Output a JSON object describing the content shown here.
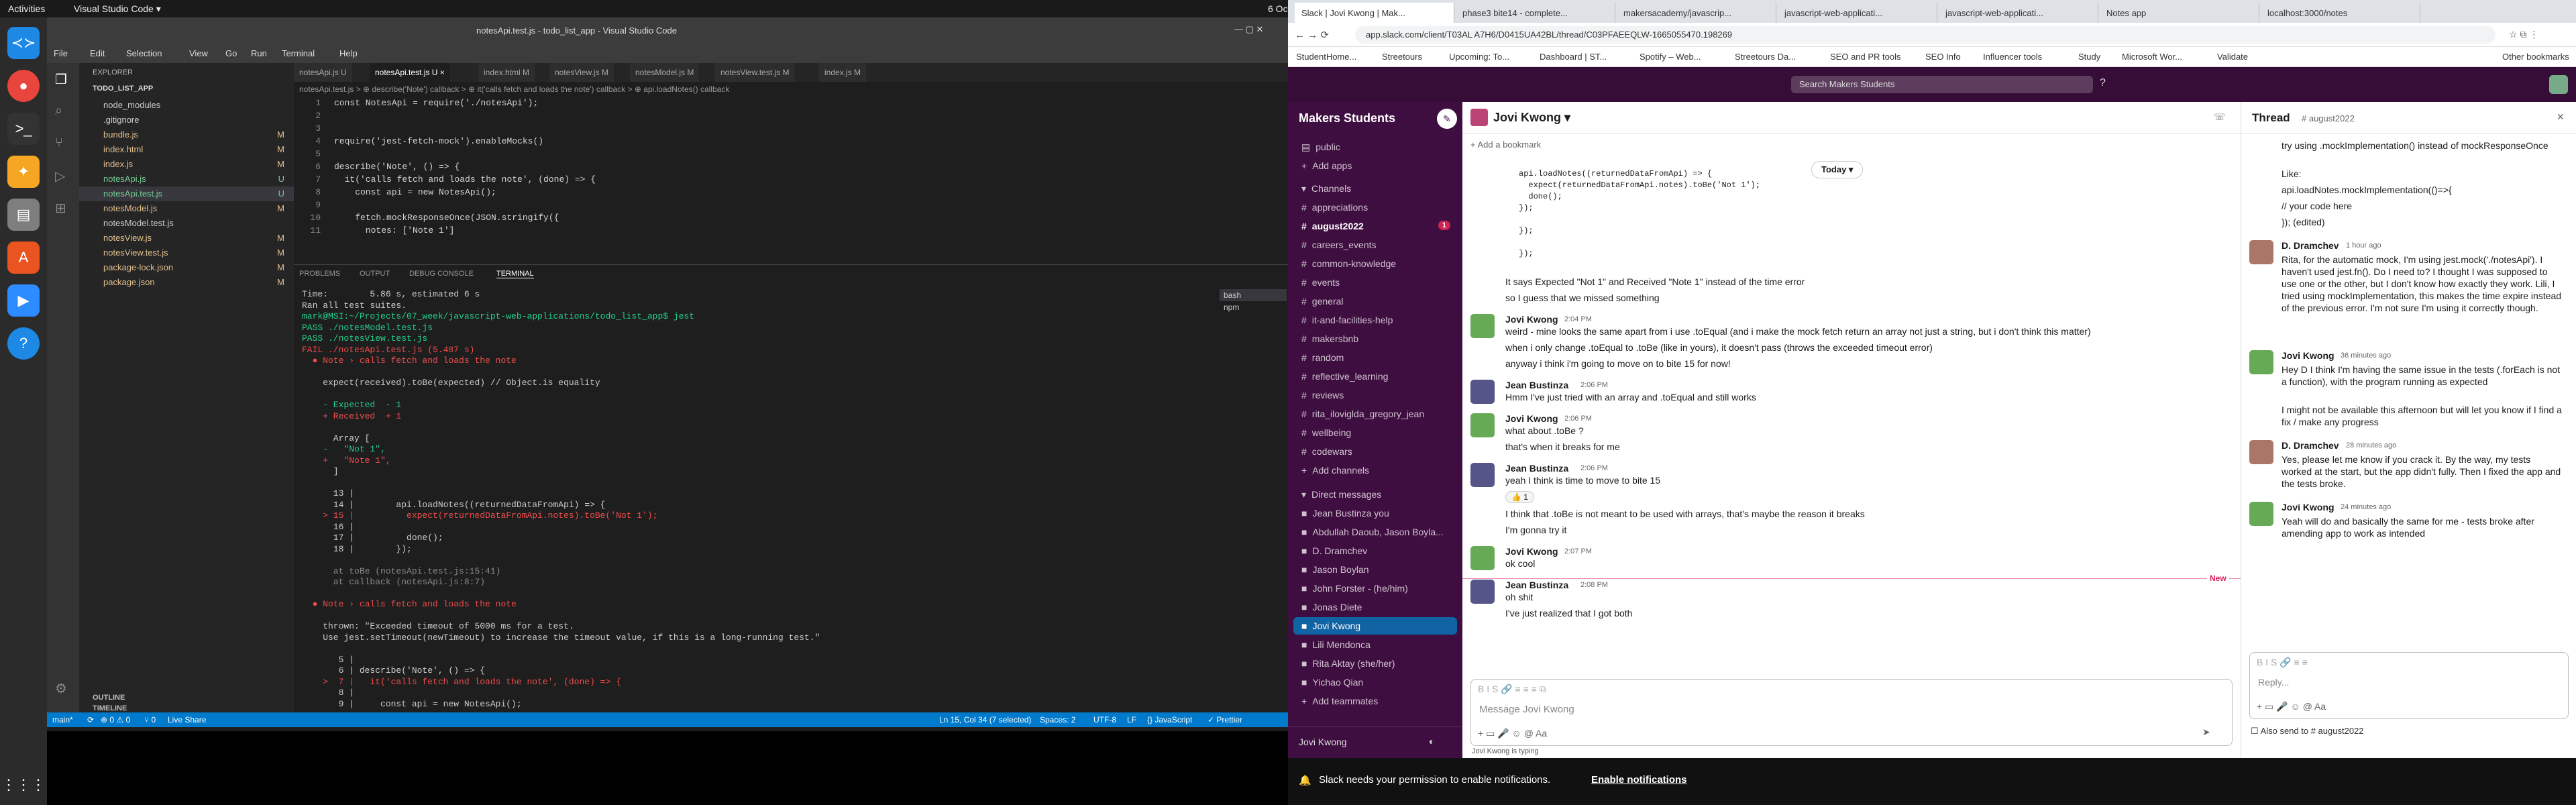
{
  "system": {
    "activities": "Activities",
    "app_name": "Visual Studio Code ▾",
    "clock": "6 Oct 14:09"
  },
  "vscode": {
    "title": "notesApi.test.js - todo_list_app - Visual Studio Code",
    "menu": [
      "File",
      "Edit",
      "Selection",
      "View",
      "Go",
      "Run",
      "Terminal",
      "Help"
    ],
    "explorer_header": "EXPLORER",
    "project": "TODO_LIST_APP",
    "files": [
      {
        "name": "node_modules",
        "badge": ""
      },
      {
        "name": ".gitignore",
        "badge": ""
      },
      {
        "name": "bundle.js",
        "badge": "M"
      },
      {
        "name": "index.html",
        "badge": "M"
      },
      {
        "name": "index.js",
        "badge": "M"
      },
      {
        "name": "notesApi.js",
        "badge": "U"
      },
      {
        "name": "notesApi.test.js",
        "badge": "U"
      },
      {
        "name": "notesModel.js",
        "badge": "M"
      },
      {
        "name": "notesModel.test.js",
        "badge": ""
      },
      {
        "name": "notesView.js",
        "badge": "M"
      },
      {
        "name": "notesView.test.js",
        "badge": "M"
      },
      {
        "name": "package-lock.json",
        "badge": "M"
      },
      {
        "name": "package.json",
        "badge": "M"
      }
    ],
    "outline": "OUTLINE",
    "timeline": "TIMELINE",
    "tabs": [
      "notesApi.js U",
      "notesApi.test.js U ×",
      "index.html M",
      "notesView.js M",
      "notesModel.js M",
      "notesView.test.js M",
      "index.js M"
    ],
    "breadcrumb": "notesApi.test.js > ⊕ describe('Note') callback > ⊕ it('calls fetch and loads the note') callback > ⊕ api.loadNotes() callback",
    "code": [
      {
        "n": "1",
        "t": "const NotesApi = require('./notesApi');"
      },
      {
        "n": "2",
        "t": ""
      },
      {
        "n": "3",
        "t": ""
      },
      {
        "n": "4",
        "t": "require('jest-fetch-mock').enableMocks()"
      },
      {
        "n": "5",
        "t": ""
      },
      {
        "n": "6",
        "t": "describe('Note', () => {"
      },
      {
        "n": "7",
        "t": "  it('calls fetch and loads the note', (done) => {"
      },
      {
        "n": "8",
        "t": "    const api = new NotesApi();"
      },
      {
        "n": "9",
        "t": ""
      },
      {
        "n": "10",
        "t": "    fetch.mockResponseOnce(JSON.stringify({"
      },
      {
        "n": "11",
        "t": "      notes: ['Note 1']"
      }
    ],
    "panel_tabs": [
      "PROBLEMS",
      "OUTPUT",
      "DEBUG CONSOLE",
      "TERMINAL"
    ],
    "terminal_side": [
      "bash",
      "npm"
    ],
    "terminal": [
      "Time:        5.86 s, estimated 6 s",
      "Ran all test suites.",
      "mark@MSI:~/Projects/07_week/javascript-web-applications/todo_list_app$ jest",
      "PASS ./notesModel.test.js",
      "PASS ./notesView.test.js",
      "FAIL ./notesApi.test.js (5.487 s)",
      "  ● Note › calls fetch and loads the note",
      "",
      "    expect(received).toBe(expected) // Object.is equality",
      "",
      "    - Expected  - 1",
      "    + Received  + 1",
      "",
      "      Array [",
      "    -   \"Not 1\",",
      "    +   \"Note 1\",",
      "      ]",
      "",
      "      13 |",
      "      14 |        api.loadNotes((returnedDataFromApi) => {",
      "    > 15 |          expect(returnedDataFromApi.notes).toBe('Not 1');",
      "      16 |",
      "      17 |          done();",
      "      18 |        });",
      "",
      "      at toBe (notesApi.test.js:15:41)",
      "      at callback (notesApi.js:8:7)",
      "",
      "  ● Note › calls fetch and loads the note",
      "",
      "    thrown: \"Exceeded timeout of 5000 ms for a test.",
      "    Use jest.setTimeout(newTimeout) to increase the timeout value, if this is a long-running test.\"",
      "",
      "       5 |",
      "       6 | describe('Note', () => {",
      "    >  7 |   it('calls fetch and loads the note', (done) => {",
      "       8 |",
      "       9 |     const api = new NotesApi();"
    ],
    "status": {
      "branch": "main*",
      "sync": "⟳",
      "errors": "⊗ 0 ⚠ 0",
      "ports": "⑂ 0",
      "live": "Live Share",
      "position": "Ln 15, Col 34 (7 selected)",
      "spaces": "Spaces: 2",
      "encoding": "UTF-8",
      "eol": "LF",
      "lang": "{} JavaScript",
      "prettier": "✓ Prettier"
    }
  },
  "browser": {
    "tabs": [
      "Slack | Jovi Kwong | Mak...",
      "phase3 bite14 - complete...",
      "makersacademy/javascrip...",
      "javascript-web-applicati...",
      "javascript-web-applicati...",
      "Notes app",
      "localhost:3000/notes"
    ],
    "url": "app.slack.com/client/T03AL A7H6/D0415UA42BL/thread/C03PFAEEQLW-1665055470.198269",
    "bookmarks": [
      "StudentHome...",
      "Streetours",
      "Upcoming: To...",
      "Dashboard | ST...",
      "Spotify – Web...",
      "Streetours Da...",
      "SEO and PR tools",
      "SEO Info",
      "Influencer tools",
      "Study",
      "Microsoft Wor...",
      "Validate",
      "Other bookmarks"
    ]
  },
  "slack": {
    "search_placeholder": "Search Makers Students",
    "workspace": "Makers Students",
    "sidebar_top": [
      "public",
      "Add apps"
    ],
    "channels_header": "Channels",
    "channels": [
      {
        "name": "appreciations",
        "bold": false
      },
      {
        "name": "august2022",
        "bold": true,
        "badge": "1"
      },
      {
        "name": "careers_events",
        "bold": false
      },
      {
        "name": "common-knowledge",
        "bold": false
      },
      {
        "name": "events",
        "bold": false
      },
      {
        "name": "general",
        "bold": false
      },
      {
        "name": "it-and-facilities-help",
        "bold": false
      },
      {
        "name": "makersbnb",
        "bold": false
      },
      {
        "name": "random",
        "bold": false
      },
      {
        "name": "reflective_learning",
        "bold": false
      },
      {
        "name": "reviews",
        "bold": false
      },
      {
        "name": "rita_iloviglda_gregory_jean",
        "bold": false
      },
      {
        "name": "wellbeing",
        "bold": false
      },
      {
        "name": "codewars",
        "bold": false
      }
    ],
    "add_channels": "Add channels",
    "dm_header": "Direct messages",
    "dms": [
      {
        "name": "Jean Bustinza  you",
        "active": false
      },
      {
        "name": "Abdullah Daoub, Jason Boyla...",
        "active": false
      },
      {
        "name": "D. Dramchev",
        "active": false
      },
      {
        "name": "Jason Boylan",
        "active": false
      },
      {
        "name": "John Forster - (he/him)",
        "active": false
      },
      {
        "name": "Jonas Diete",
        "active": false
      },
      {
        "name": "Jovi Kwong",
        "active": true
      },
      {
        "name": "Lili Mendonca",
        "active": false
      },
      {
        "name": "Rita Aktay (she/her)",
        "active": false
      },
      {
        "name": "Yichao Qian",
        "active": false
      }
    ],
    "add_teammates": "Add teammates",
    "footer_user": "Jovi Kwong",
    "channel_title": "Jovi Kwong ▾",
    "add_bookmark": "+ Add a bookmark",
    "date_pill": "Today ▾",
    "code_snippet": [
      "api.loadNotes((returnedDataFromApi) => {",
      "  expect(returnedDataFromApi.notes).toBe('Not 1');",
      "  done();",
      "});",
      "",
      "});",
      "",
      "});"
    ],
    "messages": [
      {
        "author": "",
        "time": "",
        "text": "It says Expected \"Not 1\" and Received \"Note 1\" instead of the time error"
      },
      {
        "author": "",
        "time": "",
        "text": "so I guess that we missed something"
      },
      {
        "author": "Jovi Kwong",
        "time": "2:04 PM",
        "text": "weird - mine looks the same apart from i use .toEqual (and i make the mock fetch return an array not just a string, but i don't think this matter)"
      },
      {
        "author": "",
        "time": "",
        "text": "when i only change .toEqual to .toBe (like in yours), it doesn't pass (throws the exceeded timeout error)"
      },
      {
        "author": "",
        "time": "",
        "text": "anyway i think i'm going to move on to bite 15 for now!"
      },
      {
        "author": "Jean Bustinza",
        "time": "2:06 PM",
        "text": "Hmm I've just tried with an array and .toEqual and still works"
      },
      {
        "author": "Jovi Kwong",
        "time": "2:06 PM",
        "text": "what about .toBe ?"
      },
      {
        "author": "",
        "time": "",
        "text": "that's when it breaks for me"
      },
      {
        "author": "Jean Bustinza",
        "time": "2:06 PM",
        "text": "yeah I think is time to move to bite 15"
      },
      {
        "author": "",
        "time": "",
        "text": "I think that .toBe is not meant to be used with arrays, that's maybe the reason it breaks"
      },
      {
        "author": "",
        "time": "",
        "text": "I'm gonna try it"
      },
      {
        "author": "Jovi Kwong",
        "time": "2:07 PM",
        "text": "ok cool"
      },
      {
        "author": "Jean Bustinza",
        "time": "2:08 PM",
        "text": "oh shit"
      },
      {
        "author": "",
        "time": "",
        "text": "I've just realized that I got both"
      }
    ],
    "new_label": "New",
    "reaction": "👍 1",
    "composer_placeholder": "Message Jovi Kwong",
    "typing": "Jovi Kwong is typing",
    "thread_title": "Thread",
    "thread_channel": "# august2022",
    "thread_messages": [
      {
        "author": "",
        "time": "",
        "text": "try using .mockImplementation() instead of mockResponseOnce"
      },
      {
        "author": "",
        "time": "",
        "text": "Like:"
      },
      {
        "author": "",
        "time": "",
        "text": "api.loadNotes.mockImplementation(()=>{"
      },
      {
        "author": "",
        "time": "",
        "text": "  // your code here"
      },
      {
        "author": "",
        "time": "",
        "text": "}); (edited)"
      },
      {
        "author": "D. Dramchev",
        "time": "1 hour ago",
        "text": "Rita, for the automatic mock, I'm using jest.mock('./notesApi'). I haven't used jest.fn(). Do I need to? I thought I was supposed to use one or the other, but I don't know how exactly they work. Lili, I tried using mockImplementation, this makes the time expire instead of the previous error. I'm not sure I'm using it correctly though."
      },
      {
        "author": "Jovi Kwong",
        "time": "36 minutes ago",
        "text": "Hey D I think I'm having the same issue in the tests (.forEach is not a function), with the program running as expected"
      },
      {
        "author": "",
        "time": "",
        "text": "I might not be available this afternoon but will let you know if I find a fix / make any progress"
      },
      {
        "author": "D. Dramchev",
        "time": "28 minutes ago",
        "text": "Yes, please let me know if you crack it. By the way, my tests worked at the start, but the app didn't fully. Then I fixed the app and the tests broke."
      },
      {
        "author": "Jovi Kwong",
        "time": "24 minutes ago",
        "text": "Yeah will do and basically the same for me - tests broke after amending app to work as intended"
      }
    ],
    "reply_placeholder": "Reply...",
    "also_send": "Also send to # august2022",
    "notification": "Slack needs your permission to enable notifications.",
    "notification_link": "Enable notifications"
  }
}
